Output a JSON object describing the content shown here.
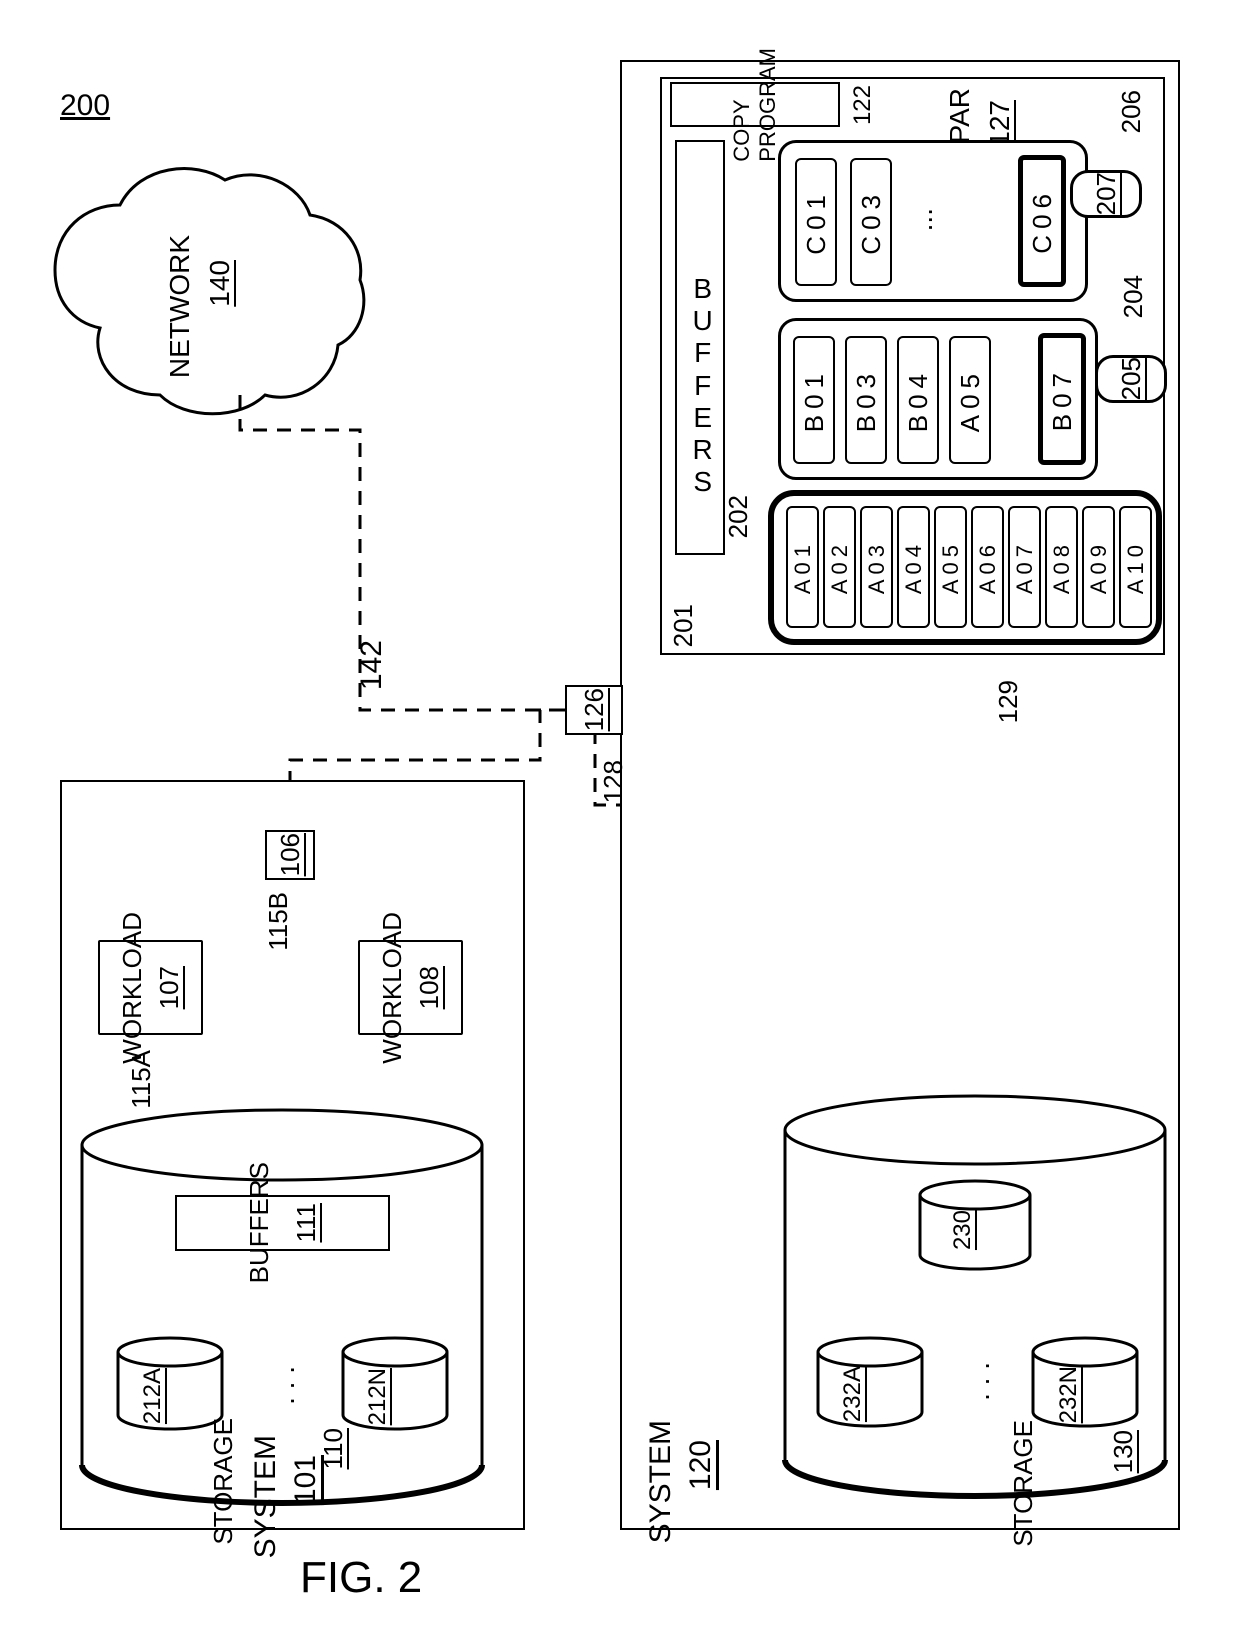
{
  "figureLabel": "FIG. 2",
  "diagramRef": "200",
  "network": {
    "label": "NETWORK",
    "ref": "140"
  },
  "linkRefs": {
    "link142": "142",
    "node126": "126",
    "link128": "128",
    "link129": "129",
    "link106": "106",
    "link115A": "115A",
    "link115B": "115B"
  },
  "system101": {
    "title": "SYSTEM",
    "ref": "101",
    "workloads": [
      {
        "label": "WORKLOAD",
        "ref": "107"
      },
      {
        "label": "WORKLOAD",
        "ref": "108"
      }
    ],
    "storage": {
      "title": "STORAGE",
      "ref": "110",
      "buffersLabel": "BUFFERS",
      "buffersRef": "111",
      "volumes": [
        "212A",
        "212N"
      ],
      "ellipsis": ". . ."
    }
  },
  "system120": {
    "title": "SYSTEM",
    "ref": "120",
    "lpar": {
      "title": "LPAR",
      "ref": "127"
    },
    "copyProgram": {
      "label": "COPY PROGRAM",
      "ref": "122"
    },
    "buffersVertical": "BUFFERS",
    "bufferGroupRefs": {
      "group206": "206",
      "group204": "204",
      "group202": "202",
      "group201": "201",
      "callout207": "207",
      "callout205": "205"
    },
    "group206_cells": [
      {
        "code": "C01"
      },
      {
        "code": "C03"
      },
      {
        "ellipsis": "..."
      },
      {
        "code": "C06",
        "bold": true
      }
    ],
    "group204_cells": [
      {
        "code": "B01"
      },
      {
        "code": "B03"
      },
      {
        "code": "B04"
      },
      {
        "code": "A05"
      },
      {
        "code": "B07",
        "bold": true
      }
    ],
    "group202_cells": [
      {
        "code": "A01"
      },
      {
        "code": "A02"
      },
      {
        "code": "A03"
      },
      {
        "code": "A04"
      },
      {
        "code": "A05"
      },
      {
        "code": "A06"
      },
      {
        "code": "A07"
      },
      {
        "code": "A08"
      },
      {
        "code": "A09"
      },
      {
        "code": "A10"
      }
    ],
    "storage": {
      "title": "STORAGE",
      "ref": "130",
      "topVolume": "230",
      "volumes": [
        "232A",
        "232N"
      ],
      "ellipsis": ". . ."
    }
  }
}
